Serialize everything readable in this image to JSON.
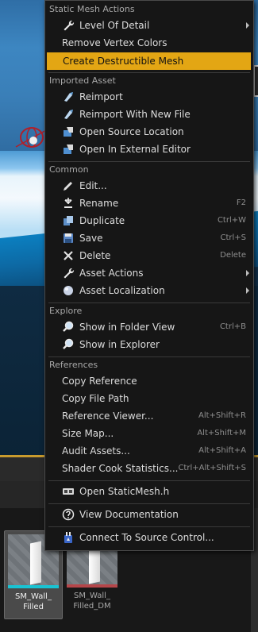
{
  "colors": {
    "menu_bg": "#161616",
    "highlight": "#e3a614",
    "text": "#dcdcdc",
    "section": "#a8a8a8",
    "shortcut": "#8e8e8e"
  },
  "menu": {
    "sections": [
      {
        "title": "Static Mesh Actions"
      },
      {
        "title": "Imported Asset"
      },
      {
        "title": "Common"
      },
      {
        "title": "Explore"
      },
      {
        "title": "References"
      }
    ],
    "items": {
      "level_of_detail": {
        "label": "Level Of Detail",
        "icon": "wrench-icon",
        "submenu": true
      },
      "remove_vertex_colors": {
        "label": "Remove Vertex Colors"
      },
      "create_destructible_mesh": {
        "label": "Create Destructible Mesh",
        "highlighted": true
      },
      "reimport": {
        "label": "Reimport",
        "icon": "reimport-icon"
      },
      "reimport_new_file": {
        "label": "Reimport With New File",
        "icon": "reimport-icon"
      },
      "open_source_location": {
        "label": "Open Source Location",
        "icon": "open-location-icon"
      },
      "open_external_editor": {
        "label": "Open In External Editor",
        "icon": "external-editor-icon"
      },
      "edit": {
        "label": "Edit...",
        "icon": "edit-icon"
      },
      "rename": {
        "label": "Rename",
        "shortcut": "F2",
        "icon": "rename-icon"
      },
      "duplicate": {
        "label": "Duplicate",
        "shortcut": "Ctrl+W",
        "icon": "duplicate-icon"
      },
      "save": {
        "label": "Save",
        "shortcut": "Ctrl+S",
        "icon": "save-icon"
      },
      "delete": {
        "label": "Delete",
        "shortcut": "Delete",
        "icon": "delete-icon"
      },
      "asset_actions": {
        "label": "Asset Actions",
        "icon": "wrench-icon",
        "submenu": true
      },
      "asset_localization": {
        "label": "Asset Localization",
        "icon": "globe-icon",
        "submenu": true
      },
      "show_in_folder_view": {
        "label": "Show in Folder View",
        "shortcut": "Ctrl+B",
        "icon": "magnifier-icon"
      },
      "show_in_explorer": {
        "label": "Show in Explorer",
        "icon": "magnifier-icon"
      },
      "copy_reference": {
        "label": "Copy Reference"
      },
      "copy_file_path": {
        "label": "Copy File Path"
      },
      "reference_viewer": {
        "label": "Reference Viewer...",
        "shortcut": "Alt+Shift+R"
      },
      "size_map": {
        "label": "Size Map...",
        "shortcut": "Alt+Shift+M"
      },
      "audit_assets": {
        "label": "Audit Assets...",
        "shortcut": "Alt+Shift+A"
      },
      "shader_cook_statistics": {
        "label": "Shader Cook Statistics...",
        "shortcut": "Ctrl+Alt+Shift+S"
      },
      "open_staticmesh_h": {
        "label": "Open StaticMesh.h",
        "icon": "code-file-icon"
      },
      "view_documentation": {
        "label": "View Documentation",
        "icon": "help-icon"
      },
      "connect_source_control": {
        "label": "Connect To Source Control...",
        "icon": "source-control-icon"
      }
    }
  },
  "content_browser": {
    "assets": [
      {
        "name": "SM_Wall_ Filled",
        "selected": true
      },
      {
        "name": "SM_Wall_ Filled_DM",
        "selected": false
      }
    ]
  }
}
